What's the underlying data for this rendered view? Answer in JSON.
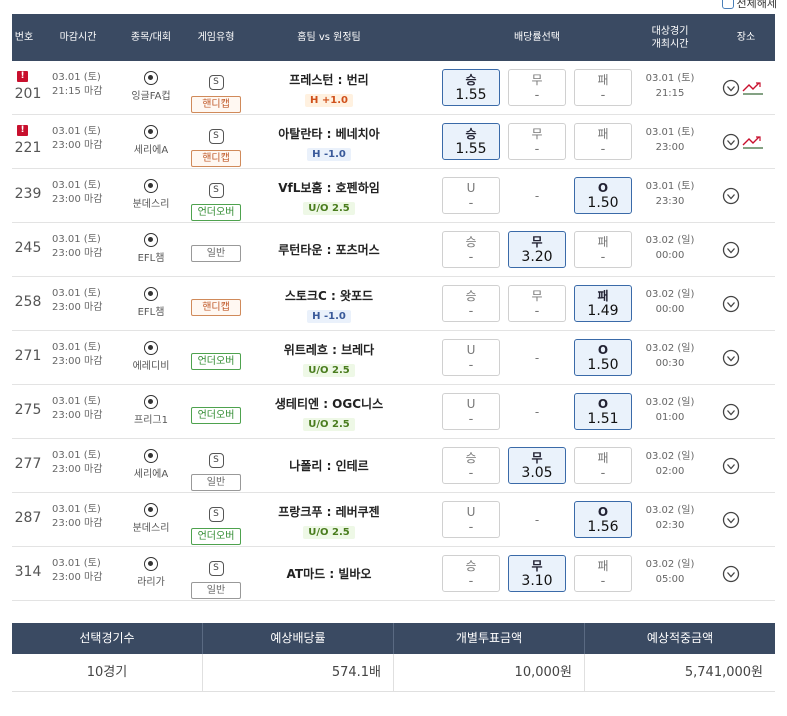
{
  "top": {
    "select_all_label": "전체해제"
  },
  "header": {
    "no": "번호",
    "deadline": "마감시간",
    "league": "종목/대회",
    "game_type": "게임유형",
    "teams": "홈팀 vs 원정팀",
    "odds": "배당률선택",
    "match_time_1": "대상경기",
    "match_time_2": "개최시간",
    "place": "장소"
  },
  "rows": [
    {
      "warn": "!",
      "no": "201",
      "date": "03.01 (토)",
      "deadline": "21:15 마감",
      "league": "잉글FA컵",
      "s_mark": "S",
      "badge": "핸디캡",
      "badge_kind": "hc",
      "teams": "프레스턴 : 번리",
      "hc": "H +1.0",
      "hc_kind": "hx",
      "odds": [
        {
          "label": "승",
          "value": "1.55",
          "sel": true
        },
        {
          "label": "무",
          "value": "-",
          "sel": false
        },
        {
          "label": "패",
          "value": "-",
          "sel": false
        }
      ],
      "mdate": "03.01 (토)",
      "mtime": "21:15",
      "trend": true
    },
    {
      "warn": "!",
      "no": "221",
      "date": "03.01 (토)",
      "deadline": "23:00 마감",
      "league": "세리에A",
      "s_mark": "S",
      "badge": "핸디캡",
      "badge_kind": "hc",
      "teams": "아탈란타 : 베네치아",
      "hc": "H -1.0",
      "hc_kind": "hb",
      "odds": [
        {
          "label": "승",
          "value": "1.55",
          "sel": true
        },
        {
          "label": "무",
          "value": "-",
          "sel": false
        },
        {
          "label": "패",
          "value": "-",
          "sel": false
        }
      ],
      "mdate": "03.01 (토)",
      "mtime": "23:00",
      "trend": true
    },
    {
      "warn": "",
      "no": "239",
      "date": "03.01 (토)",
      "deadline": "23:00 마감",
      "league": "분데스리",
      "s_mark": "S",
      "badge": "언더오버",
      "badge_kind": "uo",
      "teams": "VfL보훔 : 호펜하임",
      "hc": "U/O 2.5",
      "hc_kind": "uo",
      "odds": [
        {
          "label": "U",
          "value": "-",
          "sel": false
        },
        {
          "label": "-",
          "value": "",
          "sel": false,
          "plain": true
        },
        {
          "label": "O",
          "value": "1.50",
          "sel": true
        }
      ],
      "mdate": "03.01 (토)",
      "mtime": "23:30",
      "trend": false
    },
    {
      "warn": "",
      "no": "245",
      "date": "03.01 (토)",
      "deadline": "23:00 마감",
      "league": "EFL챔",
      "s_mark": "",
      "badge": "일반",
      "badge_kind": "",
      "teams": "루턴타운 : 포츠머스",
      "hc": "",
      "hc_kind": "",
      "odds": [
        {
          "label": "승",
          "value": "-",
          "sel": false,
          "plainbox": true
        },
        {
          "label": "무",
          "value": "3.20",
          "sel": true
        },
        {
          "label": "패",
          "value": "-",
          "sel": false
        }
      ],
      "mdate": "03.02 (일)",
      "mtime": "00:00",
      "trend": false
    },
    {
      "warn": "",
      "no": "258",
      "date": "03.01 (토)",
      "deadline": "23:00 마감",
      "league": "EFL챔",
      "s_mark": "",
      "badge": "핸디캡",
      "badge_kind": "hc",
      "teams": "스토크C : 왓포드",
      "hc": "H -1.0",
      "hc_kind": "hb",
      "odds": [
        {
          "label": "승",
          "value": "-",
          "sel": false,
          "plainbox": true
        },
        {
          "label": "무",
          "value": "-",
          "sel": false,
          "plainbox": true
        },
        {
          "label": "패",
          "value": "1.49",
          "sel": true
        }
      ],
      "mdate": "03.02 (일)",
      "mtime": "00:00",
      "trend": false
    },
    {
      "warn": "",
      "no": "271",
      "date": "03.01 (토)",
      "deadline": "23:00 마감",
      "league": "에레디비",
      "s_mark": "",
      "badge": "언더오버",
      "badge_kind": "uo",
      "teams": "위트레흐 : 브레다",
      "hc": "U/O 2.5",
      "hc_kind": "uo",
      "odds": [
        {
          "label": "U",
          "value": "-",
          "sel": false
        },
        {
          "label": "-",
          "value": "",
          "sel": false,
          "plain": true
        },
        {
          "label": "O",
          "value": "1.50",
          "sel": true
        }
      ],
      "mdate": "03.02 (일)",
      "mtime": "00:30",
      "trend": false
    },
    {
      "warn": "",
      "no": "275",
      "date": "03.01 (토)",
      "deadline": "23:00 마감",
      "league": "프리그1",
      "s_mark": "",
      "badge": "언더오버",
      "badge_kind": "uo",
      "teams": "생테티엔 : OGC니스",
      "hc": "U/O 2.5",
      "hc_kind": "uo",
      "odds": [
        {
          "label": "U",
          "value": "-",
          "sel": false
        },
        {
          "label": "-",
          "value": "",
          "sel": false,
          "plain": true
        },
        {
          "label": "O",
          "value": "1.51",
          "sel": true
        }
      ],
      "mdate": "03.02 (일)",
      "mtime": "01:00",
      "trend": false
    },
    {
      "warn": "",
      "no": "277",
      "date": "03.01 (토)",
      "deadline": "23:00 마감",
      "league": "세리에A",
      "s_mark": "S",
      "badge": "일반",
      "badge_kind": "",
      "teams": "나폴리 : 인테르",
      "hc": "",
      "hc_kind": "",
      "odds": [
        {
          "label": "승",
          "value": "-",
          "sel": false,
          "plainbox": true
        },
        {
          "label": "무",
          "value": "3.05",
          "sel": true
        },
        {
          "label": "패",
          "value": "-",
          "sel": false
        }
      ],
      "mdate": "03.02 (일)",
      "mtime": "02:00",
      "trend": false
    },
    {
      "warn": "",
      "no": "287",
      "date": "03.01 (토)",
      "deadline": "23:00 마감",
      "league": "분데스리",
      "s_mark": "S",
      "badge": "언더오버",
      "badge_kind": "uo",
      "teams": "프랑크푸 : 레버쿠젠",
      "hc": "U/O 2.5",
      "hc_kind": "uo",
      "odds": [
        {
          "label": "U",
          "value": "-",
          "sel": false
        },
        {
          "label": "-",
          "value": "",
          "sel": false,
          "plain": true
        },
        {
          "label": "O",
          "value": "1.56",
          "sel": true
        }
      ],
      "mdate": "03.02 (일)",
      "mtime": "02:30",
      "trend": false
    },
    {
      "warn": "",
      "no": "314",
      "date": "03.01 (토)",
      "deadline": "23:00 마감",
      "league": "라리가",
      "s_mark": "S",
      "badge": "일반",
      "badge_kind": "",
      "teams": "AT마드 : 빌바오",
      "hc": "",
      "hc_kind": "",
      "odds": [
        {
          "label": "승",
          "value": "-",
          "sel": false,
          "plainbox": true
        },
        {
          "label": "무",
          "value": "3.10",
          "sel": true
        },
        {
          "label": "패",
          "value": "-",
          "sel": false
        }
      ],
      "mdate": "03.02 (일)",
      "mtime": "05:00",
      "trend": false
    }
  ],
  "summary": {
    "headers": [
      "선택경기수",
      "예상배당률",
      "개별투표금액",
      "예상적중금액"
    ],
    "values": [
      "10경기",
      "574.1배",
      "10,000원",
      "5,741,000원"
    ]
  },
  "colors": {
    "header_bg": "#3a4a62",
    "selected_bg": "#eaf2fb",
    "selected_border": "#3a6aa8",
    "warn": "#c8102e"
  }
}
